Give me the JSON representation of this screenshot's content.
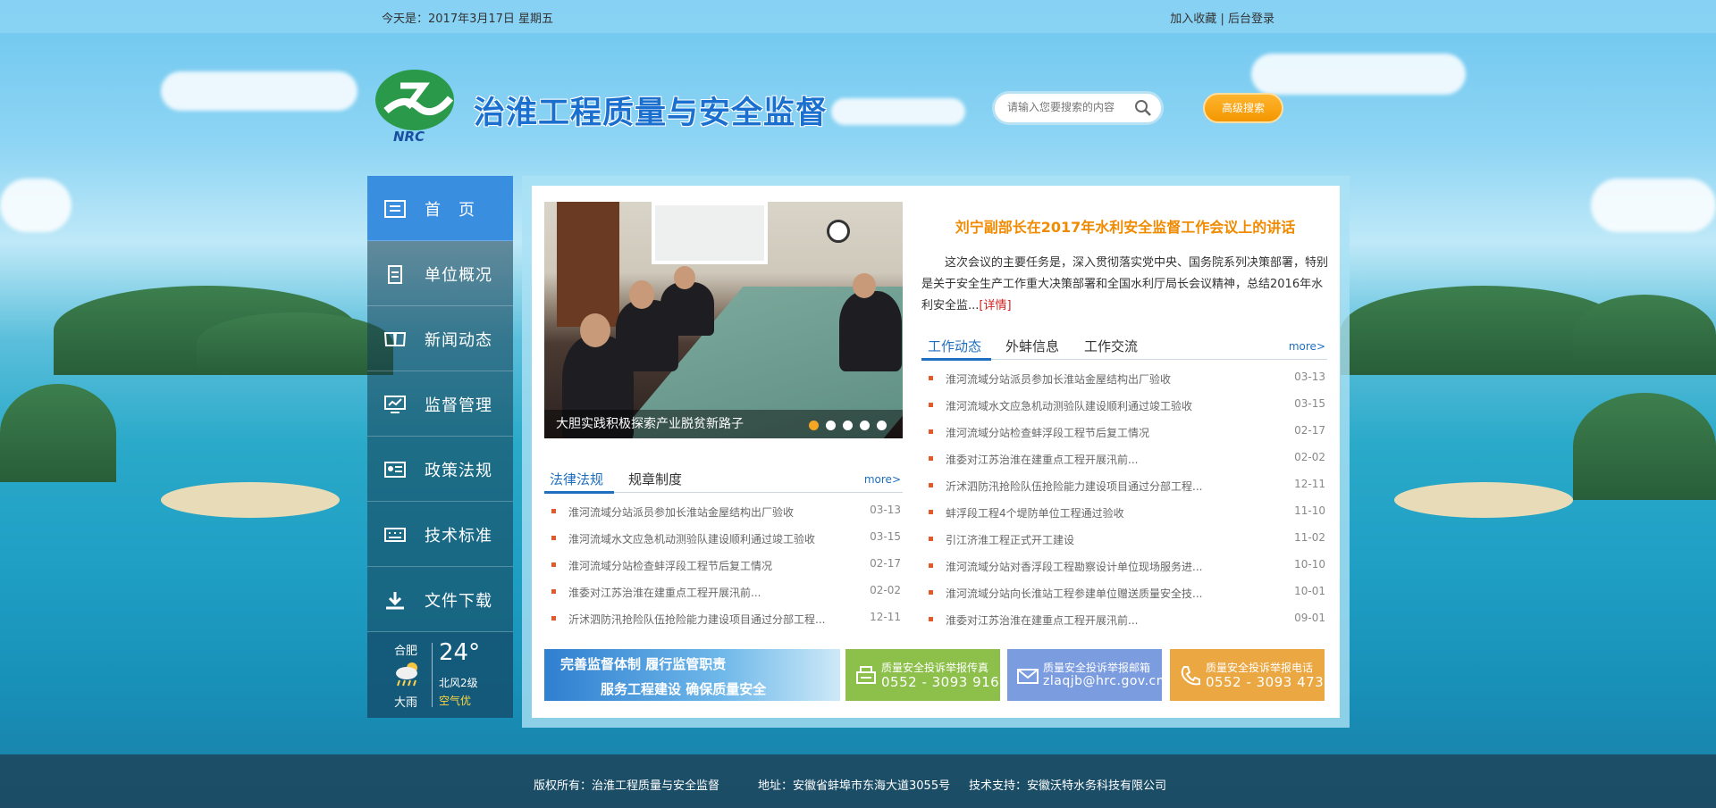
{
  "topbar": {
    "date": "今天是：2017年3月17日 星期五",
    "bookmark": "加入收藏",
    "separator": "|",
    "admin_login": "后台登录"
  },
  "header": {
    "site_title": "治淮工程质量与安全监督",
    "search_placeholder": "请输入您要搜索的内容",
    "advanced_search": "高级搜索"
  },
  "sidebar": {
    "items": [
      {
        "label": "首页",
        "icon": "home-icon",
        "active": true
      },
      {
        "label": "单位概况",
        "icon": "clipboard-icon",
        "active": false
      },
      {
        "label": "新闻动态",
        "icon": "book-icon",
        "active": false
      },
      {
        "label": "监督管理",
        "icon": "monitor-icon",
        "active": false
      },
      {
        "label": "政策法规",
        "icon": "id-card-icon",
        "active": false
      },
      {
        "label": "技术标准",
        "icon": "keyboard-icon",
        "active": false
      },
      {
        "label": "文件下载",
        "icon": "download-icon",
        "active": false
      }
    ],
    "weather": {
      "city": "合肥",
      "condition": "大雨",
      "temperature": "24°",
      "wind": "北风2级",
      "air_quality": "空气优"
    }
  },
  "slider": {
    "caption": "大胆实践积极探索产业脱贫新路子",
    "dot_count": 5,
    "active_dot": 0
  },
  "featured": {
    "headline": "刘宁副部长在2017年水利安全监督工作会议上的讲话",
    "summary": "这次会议的主要任务是，深入贯彻落实党中央、国务院系列决策部署，特别是关于安全生产工作重大决策部署和全国水利厅局长会议精神，总结2016年水利安全监...",
    "detail_link": "[详情]"
  },
  "work_news": {
    "tabs": [
      "工作动态",
      "外蚌信息",
      "工作交流"
    ],
    "more": "more>",
    "items": [
      {
        "title": "淮河流域分站派员参加长淮站金屋结构出厂验收",
        "date": "03-13"
      },
      {
        "title": "淮河流域水文应急机动测验队建设顺利通过竣工验收",
        "date": "03-15"
      },
      {
        "title": "淮河流域分站检查蚌浮段工程节后复工情况",
        "date": "02-17"
      },
      {
        "title": "淮委对江苏治淮在建重点工程开展汛前...",
        "date": "02-02"
      },
      {
        "title": "沂沭泗防汛抢险队伍抢险能力建设项目通过分部工程...",
        "date": "12-11"
      },
      {
        "title": "蚌浮段工程4个堤防单位工程通过验收",
        "date": "11-10"
      },
      {
        "title": "引江济淮工程正式开工建设",
        "date": "11-02"
      },
      {
        "title": "淮河流域分站对香浮段工程勘察设计单位现场服务进...",
        "date": "10-10"
      },
      {
        "title": "淮河流域分站向长淮站工程参建单位赠送质量安全技...",
        "date": "10-01"
      },
      {
        "title": "淮委对江苏治淮在建重点工程开展汛前...",
        "date": "09-01"
      }
    ]
  },
  "law_news": {
    "tabs": [
      "法律法规",
      "规章制度"
    ],
    "more": "more>",
    "items": [
      {
        "title": "淮河流域分站派员参加长淮站金屋结构出厂验收",
        "date": "03-13"
      },
      {
        "title": "淮河流域水文应急机动测验队建设顺利通过竣工验收",
        "date": "03-15"
      },
      {
        "title": "淮河流域分站检查蚌浮段工程节后复工情况",
        "date": "02-17"
      },
      {
        "title": "淮委对江苏治淮在建重点工程开展汛前...",
        "date": "02-02"
      },
      {
        "title": "沂沭泗防汛抢险队伍抢险能力建设项目通过分部工程...",
        "date": "12-11"
      }
    ]
  },
  "banner": {
    "line1": "完善监督体制  履行监管职责",
    "line2": "服务工程建设  确保质量安全"
  },
  "contacts": [
    {
      "title": "质量安全投诉举报传真",
      "value": "0552 - 3093 916",
      "icon": "fax-icon",
      "color": "#8cc04a"
    },
    {
      "title": "质量安全投诉举报邮箱",
      "value": "zlaqjb@hrc.gov.cn",
      "icon": "mail-icon",
      "color": "#7c9ce0"
    },
    {
      "title": "质量安全投诉举报电话",
      "value": "0552 - 3093 473",
      "icon": "phone-icon",
      "color": "#eba742"
    }
  ],
  "footer": {
    "copyright": "版权所有：治淮工程质量与安全监督",
    "address": "地址：安徽省蚌埠市东海大道3055号",
    "tech_support": "技术支持：安徽沃特水务科技有限公司"
  }
}
